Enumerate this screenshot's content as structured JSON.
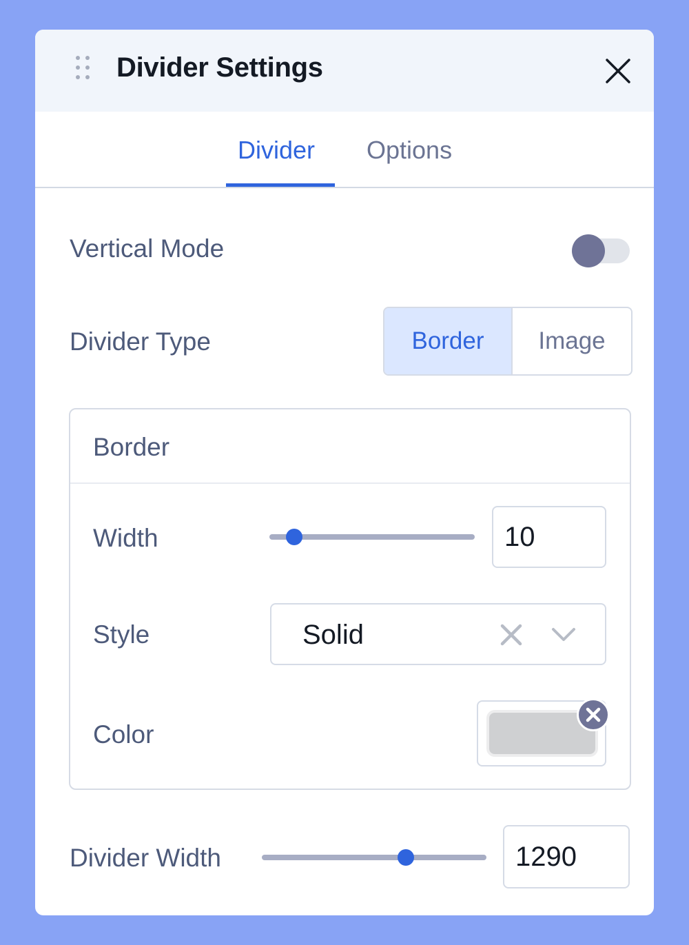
{
  "header": {
    "title": "Divider Settings"
  },
  "tabs": [
    {
      "label": "Divider",
      "active": true
    },
    {
      "label": "Options",
      "active": false
    }
  ],
  "vertical_mode": {
    "label": "Vertical Mode",
    "enabled": false
  },
  "divider_type": {
    "label": "Divider Type",
    "options": [
      "Border",
      "Image"
    ],
    "selected": "Border"
  },
  "border_group": {
    "title": "Border",
    "width": {
      "label": "Width",
      "value": "10",
      "slider_fraction": 0.12
    },
    "style": {
      "label": "Style",
      "value": "Solid"
    },
    "color": {
      "label": "Color",
      "swatch": "#cfd0d2"
    }
  },
  "divider_width": {
    "label": "Divider Width",
    "value": "1290",
    "slider_fraction": 0.64
  },
  "colors": {
    "accent": "#2f64dd",
    "background": "#88a3f5"
  }
}
